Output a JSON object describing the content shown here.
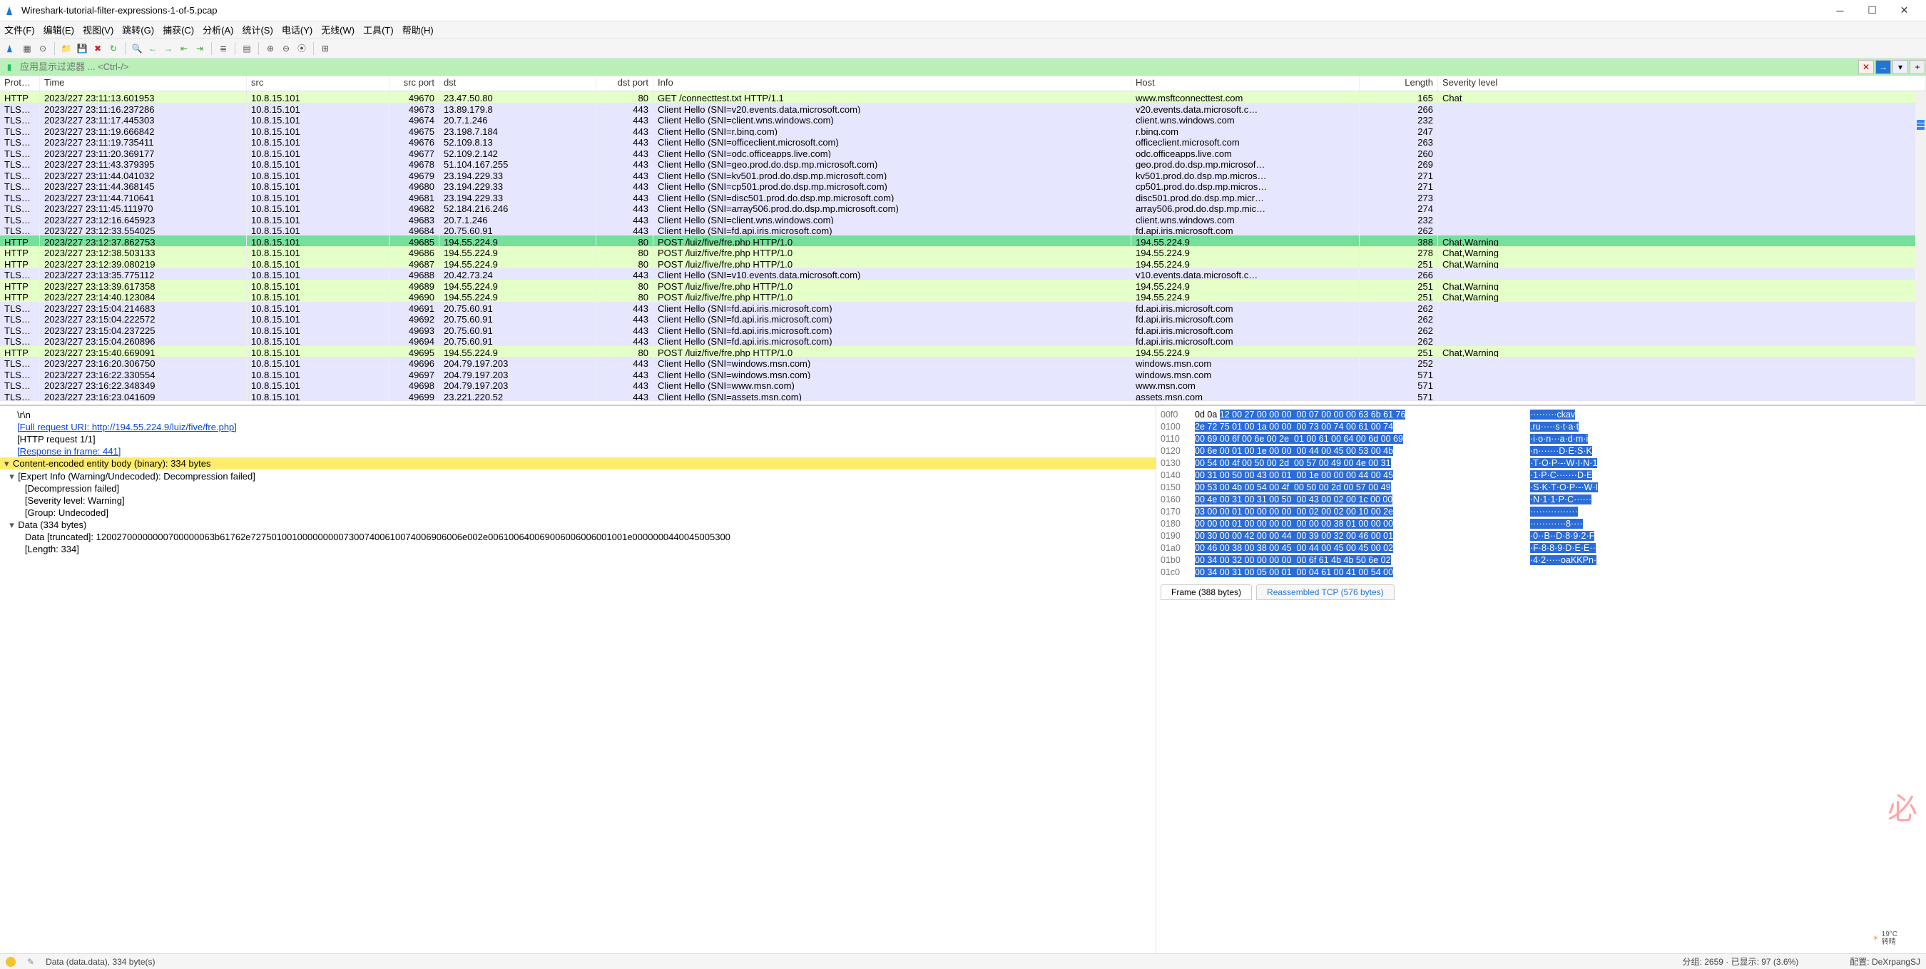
{
  "title": "Wireshark-tutorial-filter-expressions-1-of-5.pcap",
  "menu": [
    "文件(F)",
    "编辑(E)",
    "视图(V)",
    "跳转(G)",
    "捕获(C)",
    "分析(A)",
    "统计(S)",
    "电话(Y)",
    "无线(W)",
    "工具(T)",
    "帮助(H)"
  ],
  "filter_placeholder": "应用显示过滤器 ... <Ctrl-/>",
  "columns": [
    "Protocol",
    "Time",
    "src",
    "src port",
    "dst",
    "dst port",
    "Info",
    "Host",
    "Length",
    "Severity level"
  ],
  "packets": [
    {
      "proto": "HTTP",
      "cls": "http",
      "time": "2023/227 23:11:13.601953",
      "src": "10.8.15.101",
      "sport": "49670",
      "dst": "23.47.50.80",
      "dport": "80",
      "info": "GET /connecttest.txt HTTP/1.1",
      "host": "www.msftconnecttest.com",
      "len": "165",
      "sev": "Chat"
    },
    {
      "proto": "TLS…",
      "cls": "tls",
      "time": "2023/227 23:11:16.237286",
      "src": "10.8.15.101",
      "sport": "49673",
      "dst": "13.89.179.8",
      "dport": "443",
      "info": "Client Hello (SNI=v20.events.data.microsoft.com)",
      "host": "v20.events.data.microsoft.c…",
      "len": "266",
      "sev": ""
    },
    {
      "proto": "TLS…",
      "cls": "tls",
      "time": "2023/227 23:11:17.445303",
      "src": "10.8.15.101",
      "sport": "49674",
      "dst": "20.7.1.246",
      "dport": "443",
      "info": "Client Hello (SNI=client.wns.windows.com)",
      "host": "client.wns.windows.com",
      "len": "232",
      "sev": ""
    },
    {
      "proto": "TLS…",
      "cls": "tls",
      "time": "2023/227 23:11:19.666842",
      "src": "10.8.15.101",
      "sport": "49675",
      "dst": "23.198.7.184",
      "dport": "443",
      "info": "Client Hello (SNI=r.bing.com)",
      "host": "r.bing.com",
      "len": "247",
      "sev": ""
    },
    {
      "proto": "TLS…",
      "cls": "tls",
      "time": "2023/227 23:11:19.735411",
      "src": "10.8.15.101",
      "sport": "49676",
      "dst": "52.109.8.13",
      "dport": "443",
      "info": "Client Hello (SNI=officeclient.microsoft.com)",
      "host": "officeclient.microsoft.com",
      "len": "263",
      "sev": ""
    },
    {
      "proto": "TLS…",
      "cls": "tls",
      "time": "2023/227 23:11:20.369177",
      "src": "10.8.15.101",
      "sport": "49677",
      "dst": "52.109.2.142",
      "dport": "443",
      "info": "Client Hello (SNI=odc.officeapps.live.com)",
      "host": "odc.officeapps.live.com",
      "len": "260",
      "sev": ""
    },
    {
      "proto": "TLS…",
      "cls": "tls",
      "time": "2023/227 23:11:43.379395",
      "src": "10.8.15.101",
      "sport": "49678",
      "dst": "51.104.167.255",
      "dport": "443",
      "info": "Client Hello (SNI=geo.prod.do.dsp.mp.microsoft.com)",
      "host": "geo.prod.do.dsp.mp.microsof…",
      "len": "269",
      "sev": ""
    },
    {
      "proto": "TLS…",
      "cls": "tls",
      "time": "2023/227 23:11:44.041032",
      "src": "10.8.15.101",
      "sport": "49679",
      "dst": "23.194.229.33",
      "dport": "443",
      "info": "Client Hello (SNI=kv501.prod.do.dsp.mp.microsoft.com)",
      "host": "kv501.prod.do.dsp.mp.micros…",
      "len": "271",
      "sev": ""
    },
    {
      "proto": "TLS…",
      "cls": "tls",
      "time": "2023/227 23:11:44.368145",
      "src": "10.8.15.101",
      "sport": "49680",
      "dst": "23.194.229.33",
      "dport": "443",
      "info": "Client Hello (SNI=cp501.prod.do.dsp.mp.microsoft.com)",
      "host": "cp501.prod.do.dsp.mp.micros…",
      "len": "271",
      "sev": ""
    },
    {
      "proto": "TLS…",
      "cls": "tls",
      "time": "2023/227 23:11:44.710641",
      "src": "10.8.15.101",
      "sport": "49681",
      "dst": "23.194.229.33",
      "dport": "443",
      "info": "Client Hello (SNI=disc501.prod.do.dsp.mp.microsoft.com)",
      "host": "disc501.prod.do.dsp.mp.micr…",
      "len": "273",
      "sev": ""
    },
    {
      "proto": "TLS…",
      "cls": "tls",
      "time": "2023/227 23:11:45.111970",
      "src": "10.8.15.101",
      "sport": "49682",
      "dst": "52.184.216.246",
      "dport": "443",
      "info": "Client Hello (SNI=array506.prod.do.dsp.mp.microsoft.com)",
      "host": "array506.prod.do.dsp.mp.mic…",
      "len": "274",
      "sev": ""
    },
    {
      "proto": "TLS…",
      "cls": "tls",
      "time": "2023/227 23:12:16.645923",
      "src": "10.8.15.101",
      "sport": "49683",
      "dst": "20.7.1.246",
      "dport": "443",
      "info": "Client Hello (SNI=client.wns.windows.com)",
      "host": "client.wns.windows.com",
      "len": "232",
      "sev": ""
    },
    {
      "proto": "TLS…",
      "cls": "tls",
      "time": "2023/227 23:12:33.554025",
      "src": "10.8.15.101",
      "sport": "49684",
      "dst": "20.75.60.91",
      "dport": "443",
      "info": "Client Hello (SNI=fd.api.iris.microsoft.com)",
      "host": "fd.api.iris.microsoft.com",
      "len": "262",
      "sev": ""
    },
    {
      "proto": "HTTP",
      "cls": "sel",
      "time": "2023/227 23:12:37.862753",
      "src": "10.8.15.101",
      "sport": "49685",
      "dst": "194.55.224.9",
      "dport": "80",
      "info": "POST /luiz/five/fre.php HTTP/1.0",
      "host": "194.55.224.9",
      "len": "388",
      "sev": "Chat,Warning"
    },
    {
      "proto": "HTTP",
      "cls": "http",
      "time": "2023/227 23:12:38.503133",
      "src": "10.8.15.101",
      "sport": "49686",
      "dst": "194.55.224.9",
      "dport": "80",
      "info": "POST /luiz/five/fre.php HTTP/1.0",
      "host": "194.55.224.9",
      "len": "278",
      "sev": "Chat,Warning"
    },
    {
      "proto": "HTTP",
      "cls": "http",
      "time": "2023/227 23:12:39.080219",
      "src": "10.8.15.101",
      "sport": "49687",
      "dst": "194.55.224.9",
      "dport": "80",
      "info": "POST /luiz/five/fre.php HTTP/1.0",
      "host": "194.55.224.9",
      "len": "251",
      "sev": "Chat,Warning"
    },
    {
      "proto": "TLS…",
      "cls": "tls",
      "time": "2023/227 23:13:35.775112",
      "src": "10.8.15.101",
      "sport": "49688",
      "dst": "20.42.73.24",
      "dport": "443",
      "info": "Client Hello (SNI=v10.events.data.microsoft.com)",
      "host": "v10.events.data.microsoft.c…",
      "len": "266",
      "sev": ""
    },
    {
      "proto": "HTTP",
      "cls": "http",
      "time": "2023/227 23:13:39.617358",
      "src": "10.8.15.101",
      "sport": "49689",
      "dst": "194.55.224.9",
      "dport": "80",
      "info": "POST /luiz/five/fre.php HTTP/1.0",
      "host": "194.55.224.9",
      "len": "251",
      "sev": "Chat,Warning"
    },
    {
      "proto": "HTTP",
      "cls": "http",
      "time": "2023/227 23:14:40.123084",
      "src": "10.8.15.101",
      "sport": "49690",
      "dst": "194.55.224.9",
      "dport": "80",
      "info": "POST /luiz/five/fre.php HTTP/1.0",
      "host": "194.55.224.9",
      "len": "251",
      "sev": "Chat,Warning"
    },
    {
      "proto": "TLS…",
      "cls": "tls",
      "time": "2023/227 23:15:04.214683",
      "src": "10.8.15.101",
      "sport": "49691",
      "dst": "20.75.60.91",
      "dport": "443",
      "info": "Client Hello (SNI=fd.api.iris.microsoft.com)",
      "host": "fd.api.iris.microsoft.com",
      "len": "262",
      "sev": ""
    },
    {
      "proto": "TLS…",
      "cls": "tls",
      "time": "2023/227 23:15:04.222572",
      "src": "10.8.15.101",
      "sport": "49692",
      "dst": "20.75.60.91",
      "dport": "443",
      "info": "Client Hello (SNI=fd.api.iris.microsoft.com)",
      "host": "fd.api.iris.microsoft.com",
      "len": "262",
      "sev": ""
    },
    {
      "proto": "TLS…",
      "cls": "tls",
      "time": "2023/227 23:15:04.237225",
      "src": "10.8.15.101",
      "sport": "49693",
      "dst": "20.75.60.91",
      "dport": "443",
      "info": "Client Hello (SNI=fd.api.iris.microsoft.com)",
      "host": "fd.api.iris.microsoft.com",
      "len": "262",
      "sev": ""
    },
    {
      "proto": "TLS…",
      "cls": "tls",
      "time": "2023/227 23:15:04.260896",
      "src": "10.8.15.101",
      "sport": "49694",
      "dst": "20.75.60.91",
      "dport": "443",
      "info": "Client Hello (SNI=fd.api.iris.microsoft.com)",
      "host": "fd.api.iris.microsoft.com",
      "len": "262",
      "sev": ""
    },
    {
      "proto": "HTTP",
      "cls": "http",
      "time": "2023/227 23:15:40.669091",
      "src": "10.8.15.101",
      "sport": "49695",
      "dst": "194.55.224.9",
      "dport": "80",
      "info": "POST /luiz/five/fre.php HTTP/1.0",
      "host": "194.55.224.9",
      "len": "251",
      "sev": "Chat,Warning"
    },
    {
      "proto": "TLS…",
      "cls": "tls",
      "time": "2023/227 23:16:20.306750",
      "src": "10.8.15.101",
      "sport": "49696",
      "dst": "204.79.197.203",
      "dport": "443",
      "info": "Client Hello (SNI=windows.msn.com)",
      "host": "windows.msn.com",
      "len": "252",
      "sev": ""
    },
    {
      "proto": "TLS…",
      "cls": "tls",
      "time": "2023/227 23:16:22.330554",
      "src": "10.8.15.101",
      "sport": "49697",
      "dst": "204.79.197.203",
      "dport": "443",
      "info": "Client Hello (SNI=windows.msn.com)",
      "host": "windows.msn.com",
      "len": "571",
      "sev": ""
    },
    {
      "proto": "TLS…",
      "cls": "tls",
      "time": "2023/227 23:16:22.348349",
      "src": "10.8.15.101",
      "sport": "49698",
      "dst": "204.79.197.203",
      "dport": "443",
      "info": "Client Hello (SNI=www.msn.com)",
      "host": "www.msn.com",
      "len": "571",
      "sev": ""
    },
    {
      "proto": "TLS…",
      "cls": "tls",
      "time": "2023/227 23:16:23.041609",
      "src": "10.8.15.101",
      "sport": "49699",
      "dst": "23.221.220.52",
      "dport": "443",
      "info": "Client Hello (SNI=assets.msn.com)",
      "host": "assets.msn.com",
      "len": "571",
      "sev": ""
    }
  ],
  "tree": {
    "crlf": "\\r\\n",
    "full_uri_label": "[Full request URI: http://194.55.224.9/luiz/five/fre.php]",
    "req_count": "[HTTP request 1/1]",
    "response_frame": "[Response in frame: 441]",
    "content_body": "Content-encoded entity body (binary): 334 bytes",
    "expert": "[Expert Info (Warning/Undecoded): Decompression failed]",
    "decomp": "[Decompression failed]",
    "sev": "[Severity level: Warning]",
    "group": "[Group: Undecoded]",
    "data_node": "Data (334 bytes)",
    "data_trunc": "Data [truncated]: 12002700000000700000063b61762e72750100100000000073007400610074006906006e002e006100640069006006006001001e0000000440045005300",
    "len_node": "[Length: 334]"
  },
  "hex": {
    "rows": [
      {
        "off": "00f0",
        "b1": "0d 0a ",
        "b2": "12 00 27 00 00 00  00 07 00 00 00 63 6b 61 76",
        "a": "·········ckav"
      },
      {
        "off": "0100",
        "b1": "",
        "b2": "2e 72 75 01 00 1a 00 00  00 73 00 74 00 61 00 74",
        "a": ".ru·····s·t·a·t"
      },
      {
        "off": "0110",
        "b1": "",
        "b2": "00 69 00 6f 00 6e 00 2e  01 00 61 00 64 00 6d 00 69",
        "a": "·i·o·n···a·d·m·i"
      },
      {
        "off": "0120",
        "b1": "",
        "b2": "00 6e 00 01 00 1e 00 00  00 44 00 45 00 53 00 4b",
        "a": "·n·······D·E·S·K"
      },
      {
        "off": "0130",
        "b1": "",
        "b2": "00 54 00 4f 00 50 00 2d  00 57 00 49 00 4e 00 31",
        "a": "·T·O·P·-·W·I·N·1"
      },
      {
        "off": "0140",
        "b1": "",
        "b2": "00 31 00 50 00 43 00 01  00 1e 00 00 00 44 00 45",
        "a": "·1·P·C·······D·E"
      },
      {
        "off": "0150",
        "b1": "",
        "b2": "00 53 00 4b 00 54 00 4f  00 50 00 2d 00 57 00 49",
        "a": "·S·K·T·O·P·-·W·I"
      },
      {
        "off": "0160",
        "b1": "",
        "b2": "00 4e 00 31 00 31 00 50  00 43 00 02 00 1c 00 00",
        "a": "·N·1·1·P·C······"
      },
      {
        "off": "0170",
        "b1": "",
        "b2": "03 00 00 01 00 00 00 00  00 02 00 02 00 10 00 2e",
        "a": "················"
      },
      {
        "off": "0180",
        "b1": "",
        "b2": "00 00 00 01 00 00 00 00  00 00 00 38 01 00 00 00",
        "a": "············8····"
      },
      {
        "off": "0190",
        "b1": "",
        "b2": "00 30 00 00 42 00 00 44  00 39 00 32 00 46 00 01",
        "a": "·0··B··D·8·9·2·F"
      },
      {
        "off": "01a0",
        "b1": "",
        "b2": "00 46 00 38 00 38 00 45  00 44 00 45 00 45 00 02",
        "a": "·F·8·8·9·D·E·E··"
      },
      {
        "off": "01b0",
        "b1": "",
        "b2": "00 34 00 32 00 00 00 00  00 6f 61 4b 4b 50 6e 02",
        "a": "·4·2·····oaKKPn·"
      },
      {
        "off": "01c0",
        "b1": "",
        "b2": "00 34 00 31 00 05 00 01  00 04 61 00 41 00 54 00",
        "a": ""
      }
    ],
    "tab_frame": "Frame (388 bytes)",
    "tab_reasm": "Reassembled TCP (576 bytes)"
  },
  "status": {
    "left": "Data (data.data), 334 byte(s)",
    "right": "分组: 2659 · 已显示: 97 (3.6%)",
    "profile": "配置: DeXrpangSJ"
  },
  "weather": "19°C\n转晴"
}
